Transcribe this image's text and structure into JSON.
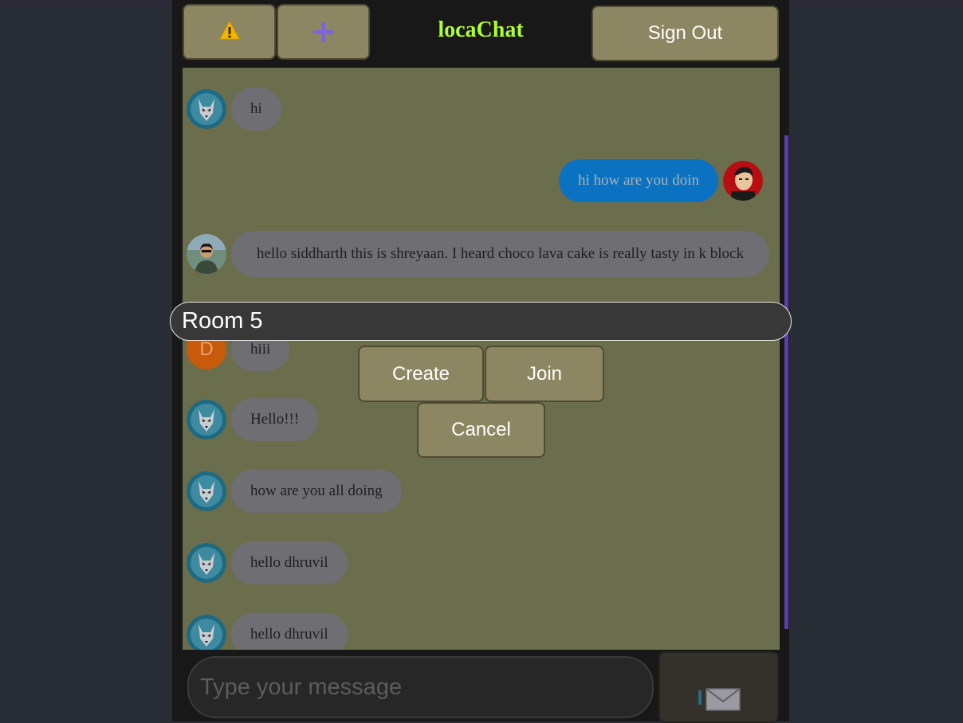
{
  "app": {
    "title": "locaChat"
  },
  "header": {
    "warning_icon": "warning-icon",
    "add_icon": "plus-icon",
    "sign_out_label": "Sign Out"
  },
  "messages": [
    {
      "avatar": "wolf-avatar",
      "text": "hi",
      "side": "received"
    },
    {
      "avatar": "user-photo-avatar",
      "text": "hi how are you doin",
      "side": "sent"
    },
    {
      "avatar": "boy-photo-avatar",
      "text": "hello siddharth this is shreyaan. I heard choco lava cake is really tasty in k block",
      "side": "received"
    },
    {
      "avatar_letter": "D",
      "text": "hiii",
      "side": "received"
    },
    {
      "avatar": "wolf-avatar",
      "text": "Hello!!!",
      "side": "received"
    },
    {
      "avatar": "wolf-avatar",
      "text": "how are you all doing",
      "side": "received"
    },
    {
      "avatar": "wolf-avatar",
      "text": "hello dhruvil",
      "side": "received"
    },
    {
      "avatar": "wolf-avatar",
      "text": "hello dhruvil",
      "side": "received"
    }
  ],
  "room_dialog": {
    "room_input_value": "Room 5",
    "create_label": "Create",
    "join_label": "Join",
    "cancel_label": "Cancel"
  },
  "composer": {
    "placeholder": "Type your message",
    "send_icon": "envelope-icon"
  },
  "colors": {
    "accent_title": "#adff2f",
    "button_bg": "#8c8662",
    "chat_bg": "#6b6e4c",
    "sent_bubble": "#0a72c0",
    "received_bubble": "#6f6e72"
  }
}
